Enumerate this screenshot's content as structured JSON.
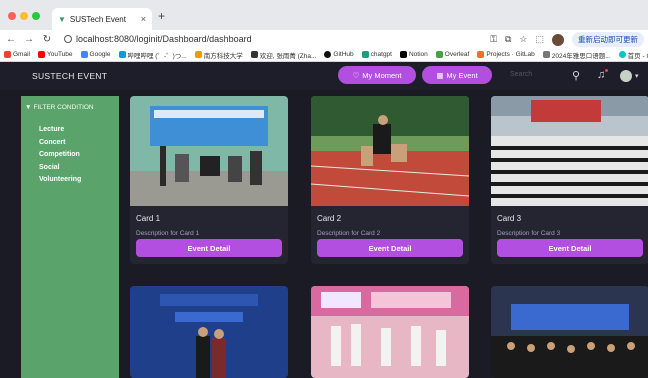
{
  "browser": {
    "tab_title": "SUSTech Event",
    "url": "localhost:8080/loginit/Dashboard/dashboard",
    "update_label": "重新启动即可更新",
    "bookmarks": [
      "Gmail",
      "YouTube",
      "Google",
      "哔哩哔哩 (゜-゜)つ...",
      "南方科技大学",
      "欢迎, 张雨菁 (Zha...",
      "GitHub",
      "chatgpt",
      "Notion",
      "Overleaf",
      "Projects · GitLab",
      "2024年雅思口语题...",
      "首页 - Canva可画"
    ]
  },
  "header": {
    "brand": "SUSTECH EVENT",
    "my_moment": "My Moment",
    "my_event": "My Event",
    "search_placeholder": "Search"
  },
  "sidebar": {
    "title": "FILTER CONDITION",
    "items": [
      "Lecture",
      "Concert",
      "Competition",
      "Social",
      "Volunteering"
    ]
  },
  "cards": [
    {
      "title": "Card 1",
      "description": "Description for Card 1",
      "button": "Event Detail"
    },
    {
      "title": "Card 2",
      "description": "Description for Card 2",
      "button": "Event Detail"
    },
    {
      "title": "Card 3",
      "description": "Description for Card 3",
      "button": "Event Detail"
    }
  ],
  "colors": {
    "accent": "#b24fe0",
    "sidebar": "#5aa46c",
    "background": "#1b1b26",
    "card": "#252532"
  }
}
